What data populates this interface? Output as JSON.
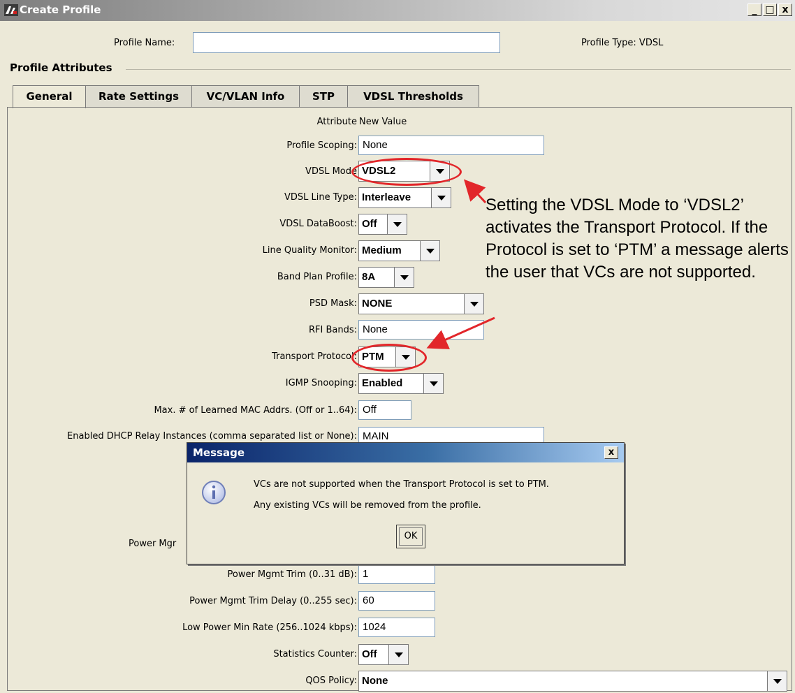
{
  "window": {
    "title": "Create Profile",
    "controls": {
      "minimize": "_",
      "maximize": "□",
      "close": "x"
    }
  },
  "header": {
    "profile_name_label": "Profile Name:",
    "profile_name_value": "",
    "profile_type_label": "Profile Type:  VDSL"
  },
  "section": {
    "title": "Profile Attributes"
  },
  "tabs": [
    {
      "label": "General",
      "active": true
    },
    {
      "label": "Rate Settings",
      "active": false
    },
    {
      "label": "VC/VLAN Info",
      "active": false
    },
    {
      "label": "STP",
      "active": false
    },
    {
      "label": "VDSL Thresholds",
      "active": false
    }
  ],
  "form": {
    "column_headers": {
      "attribute": "Attribute",
      "new_value": "New Value"
    },
    "profile_scoping": {
      "label": "Profile Scoping:",
      "value": "None"
    },
    "vdsl_mode": {
      "label": "VDSL Mode",
      "value": "VDSL2"
    },
    "vdsl_line_type": {
      "label": "VDSL Line Type:",
      "value": "Interleave"
    },
    "vdsl_databoost": {
      "label": "VDSL DataBoost:",
      "value": "Off"
    },
    "line_quality_monitor": {
      "label": "Line Quality Monitor:",
      "value": "Medium"
    },
    "band_plan_profile": {
      "label": "Band Plan Profile:",
      "value": "8A"
    },
    "psd_mask": {
      "label": "PSD Mask:",
      "value": "NONE"
    },
    "rfi_bands": {
      "label": "RFI Bands:",
      "value": "None"
    },
    "transport_protocol": {
      "label": "Transport Protocol:",
      "value": "PTM"
    },
    "igmp_snooping": {
      "label": "IGMP Snooping:",
      "value": "Enabled"
    },
    "max_learned_mac": {
      "label": "Max. # of Learned MAC Addrs. (Off or 1..64):",
      "value": "Off"
    },
    "dhcp_relay": {
      "label": "Enabled DHCP Relay Instances (comma separated list or None):",
      "value": "MAIN"
    },
    "power_mgmt_partial": {
      "label": "Power Mgr"
    },
    "power_mgmt_trim": {
      "label": "Power Mgmt Trim (0..31 dB):",
      "value": "1"
    },
    "power_mgmt_trim_delay": {
      "label": "Power Mgmt Trim Delay (0..255 sec):",
      "value": "60"
    },
    "low_power_min_rate": {
      "label": "Low Power Min Rate (256..1024 kbps):",
      "value": "1024"
    },
    "statistics_counter": {
      "label": "Statistics Counter:",
      "value": "Off"
    },
    "qos_policy": {
      "label": "QOS Policy:",
      "value": "None"
    }
  },
  "callout": {
    "text": "Setting the VDSL Mode to ‘VDSL2’ activates the Transport Protocol. If the Protocol is set to ‘PTM’ a message alerts the user that VCs are not supported.",
    "color": "#e2262a"
  },
  "dialog": {
    "title": "Message",
    "line1": "VCs are not supported when the Transport Protocol is set to PTM.",
    "line2": "Any existing VCs will be removed from the profile.",
    "ok_label": "OK",
    "close_label": "x",
    "icon": "info-icon"
  }
}
